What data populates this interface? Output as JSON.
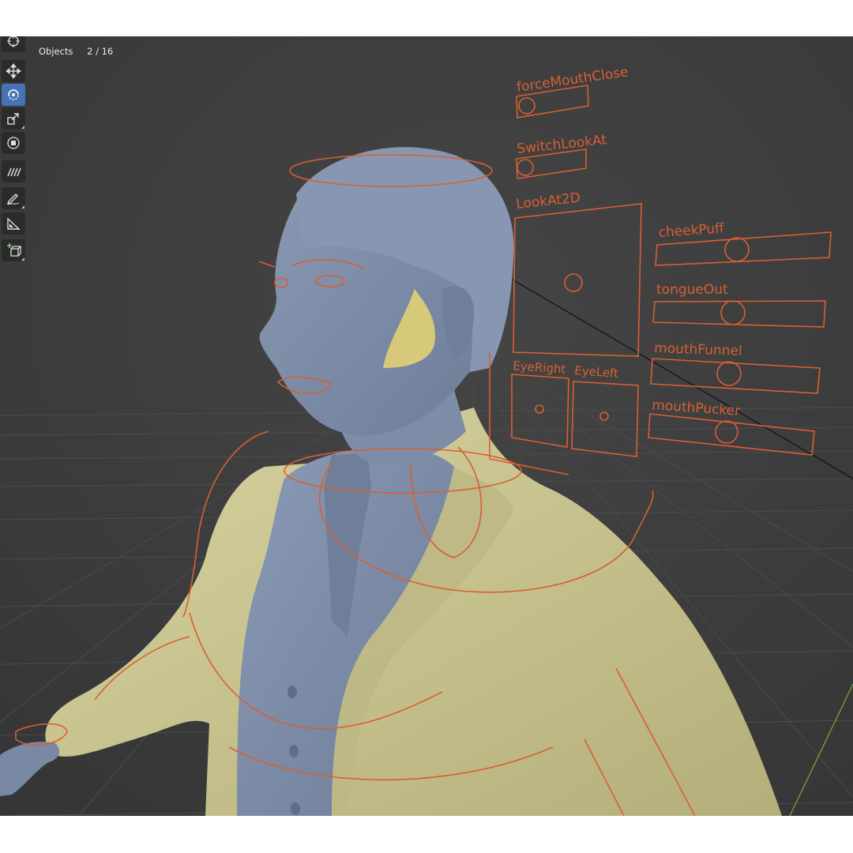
{
  "viewport": {
    "stats": {
      "label": "Objects",
      "count": "2 / 16"
    }
  },
  "toolbar": {
    "tools": [
      {
        "name": "cursor-tool",
        "icon": "cursor-icon",
        "active": false
      },
      {
        "name": "move-tool",
        "icon": "move-icon",
        "active": false
      },
      {
        "name": "rotate-tool",
        "icon": "rotate-icon",
        "active": true
      },
      {
        "name": "scale-tool",
        "icon": "scale-icon",
        "active": false
      },
      {
        "name": "transform-tool",
        "icon": "transform-icon",
        "active": false
      },
      {
        "name": "annotate-tool",
        "icon": "annotate-icon",
        "active": false
      },
      {
        "name": "draw-tool",
        "icon": "pencil-icon",
        "active": false
      },
      {
        "name": "measure-tool",
        "icon": "measure-icon",
        "active": false
      },
      {
        "name": "add-cube-tool",
        "icon": "add-cube-icon",
        "active": false
      }
    ]
  },
  "rig_controls": {
    "force_mouth_close": "forceMouthClose",
    "switch_look_at": "SwitchLookAt",
    "look_at_2d": "LookAt2D",
    "eye_right": "EyeRight",
    "eye_left": "EyeLeft",
    "cheek_puff": "cheekPuff",
    "tongue_out": "tongueOut",
    "mouth_funnel": "mouthFunnel",
    "mouth_pucker": "mouthPucker"
  },
  "colors": {
    "viewport_bg": "#3d3d3d",
    "rig_orange": "#d85f32",
    "body_blue": "#7e8ea9",
    "jacket_yellow": "#c9c48f",
    "active_tool": "#4772b3"
  }
}
